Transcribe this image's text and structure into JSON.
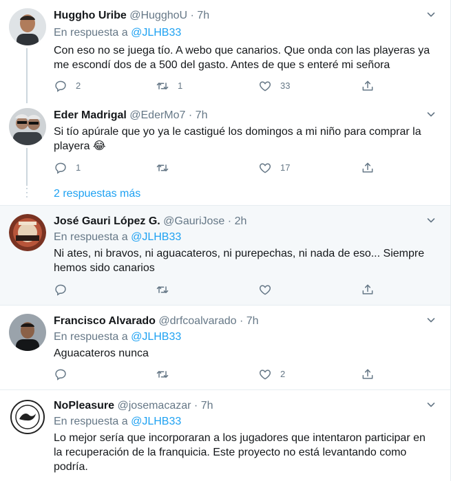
{
  "thread": {
    "more_replies_label": "2 respuestas más"
  },
  "tweets": [
    {
      "name": "Huggho Uribe",
      "handle": "@HugghoU",
      "dot": "·",
      "time": "7h",
      "reply_prefix": "En respuesta a",
      "reply_mention": "@JLHB33",
      "lines": [
        "Con eso no se juega tío. A webo que canarios. Que onda con las playeras ya",
        "me escondí dos de a 500 del gasto. Antes de que s enteré mi señora"
      ],
      "replies": "2",
      "retweets": "1",
      "likes": "33"
    },
    {
      "name": "Eder Madrigal",
      "handle": "@EderMo7",
      "dot": "·",
      "time": "7h",
      "lines": [
        "Si tío apúrale que yo ya le castigué los domingos a mi niño para comprar la",
        "playera 😂"
      ],
      "replies": "1",
      "retweets": "",
      "likes": "17"
    },
    {
      "name": "José Gauri López G.",
      "handle": "@GauriJose",
      "dot": "·",
      "time": "2h",
      "reply_prefix": "En respuesta a",
      "reply_mention": "@JLHB33",
      "lines": [
        "Ni ates, ni bravos, ni aguacateros, ni purepechas, ni nada de eso... Siempre",
        "hemos sido canarios"
      ],
      "replies": "",
      "retweets": "",
      "likes": ""
    },
    {
      "name": "Francisco Alvarado",
      "handle": "@drfcoalvarado",
      "dot": "·",
      "time": "7h",
      "reply_prefix": "En respuesta a",
      "reply_mention": "@JLHB33",
      "lines": [
        "Aguacateros nunca"
      ],
      "replies": "",
      "retweets": "",
      "likes": "2"
    },
    {
      "name": "NoPleasure",
      "handle": "@josemacazar",
      "dot": "·",
      "time": "7h",
      "reply_prefix": "En respuesta a",
      "reply_mention": "@JLHB33",
      "lines": [
        "Lo mejor sería que incorporaran a los jugadores que intentaron participar en",
        "la recuperación de la franquicia. Este proyecto no está levantando como",
        "podría."
      ],
      "replies": "",
      "retweets": "",
      "likes": ""
    }
  ],
  "colors": {
    "text": "#14171a",
    "secondary": "#657786",
    "accent": "#1da1f2",
    "divider": "#e6ecf0",
    "highlight_bg": "#f5f8fa"
  },
  "icons": [
    "reply-icon",
    "retweet-icon",
    "like-icon",
    "share-icon",
    "chevron-down-icon"
  ]
}
